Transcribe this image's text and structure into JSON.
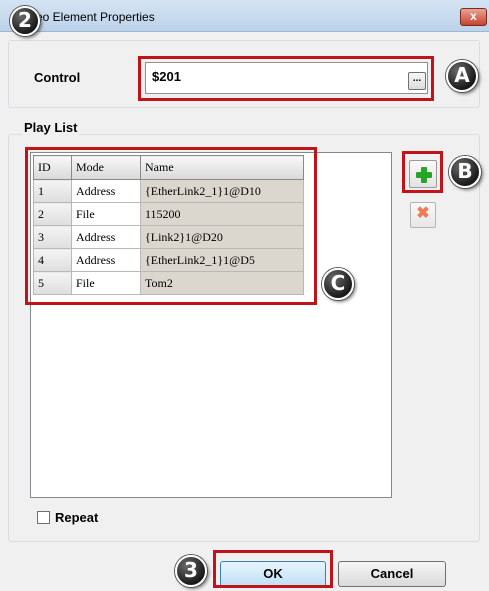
{
  "window": {
    "title": "eo Element Properties",
    "close_label": "x"
  },
  "annotations": {
    "step2": "2",
    "step3": "3",
    "label_a": "A",
    "label_b": "B",
    "label_c": "C",
    "highlight_color": "#c0141b"
  },
  "control": {
    "label": "Control",
    "value": "$201",
    "browse_label": "..."
  },
  "playlist": {
    "group_label": "Play List",
    "columns": [
      "ID",
      "Mode",
      "Name"
    ],
    "rows": [
      {
        "id": "1",
        "mode": "Address",
        "name": "{EtherLink2_1}1@D10"
      },
      {
        "id": "2",
        "mode": "File",
        "name": "115200"
      },
      {
        "id": "3",
        "mode": "Address",
        "name": "{Link2}1@D20"
      },
      {
        "id": "4",
        "mode": "Address",
        "name": "{EtherLink2_1}1@D5"
      },
      {
        "id": "5",
        "mode": "File",
        "name": "Tom2"
      }
    ],
    "add_icon": "green-plus-icon",
    "delete_icon": "orange-x-icon"
  },
  "repeat": {
    "label": "Repeat",
    "checked": false
  },
  "buttons": {
    "ok": "OK",
    "cancel": "Cancel"
  }
}
